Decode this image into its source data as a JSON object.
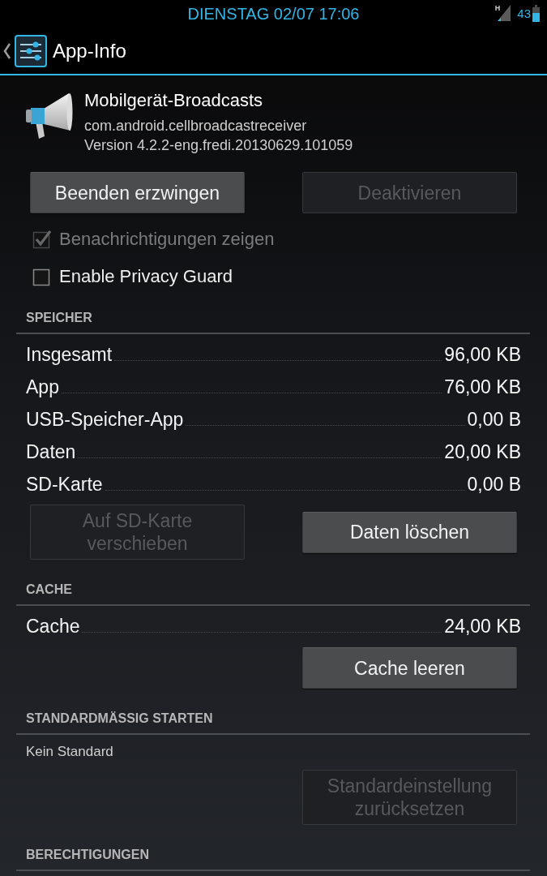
{
  "status_bar": {
    "clock": "DIENSTAG 02/07 17:06",
    "network_type": "H",
    "battery": "43"
  },
  "action_bar": {
    "title": "App-Info"
  },
  "app": {
    "name": "Mobilgerät-Broadcasts",
    "package": "com.android.cellbroadcastreceiver",
    "version": "Version 4.2.2-eng.fredi.20130629.101059"
  },
  "buttons": [
    {
      "label": "Beenden erzwingen",
      "disabled": false
    },
    {
      "label": "Deaktivieren",
      "disabled": true
    }
  ],
  "checkboxes": [
    {
      "label": "Benachrichtigungen zeigen",
      "checked": true,
      "disabled": true
    },
    {
      "label": "Enable Privacy Guard",
      "checked": false,
      "disabled": false
    }
  ],
  "sections": [
    {
      "title": "SPEICHER",
      "rows": [
        {
          "label": "Insgesamt",
          "value": "96,00 KB"
        },
        {
          "label": "App",
          "value": "76,00 KB"
        },
        {
          "label": "USB-Speicher-App",
          "value": "0,00 B"
        },
        {
          "label": "Daten",
          "value": "20,00 KB"
        },
        {
          "label": "SD-Karte",
          "value": "0,00 B"
        }
      ],
      "buttons": [
        {
          "label": "Auf SD-Karte verschieben",
          "disabled": true
        },
        {
          "label": "Daten löschen",
          "disabled": false
        }
      ]
    },
    {
      "title": "CACHE",
      "rows": [
        {
          "label": "Cache",
          "value": "24,00 KB"
        }
      ],
      "buttons": [
        {
          "label": "Cache leeren",
          "disabled": false
        }
      ]
    },
    {
      "title": "STANDARDMÄSSIG STARTEN",
      "note": "Kein Standard",
      "buttons": [
        {
          "label": "Standardeinstellung zurücksetzen",
          "disabled": true
        }
      ]
    },
    {
      "title": "BERECHTIGUNGEN"
    }
  ]
}
